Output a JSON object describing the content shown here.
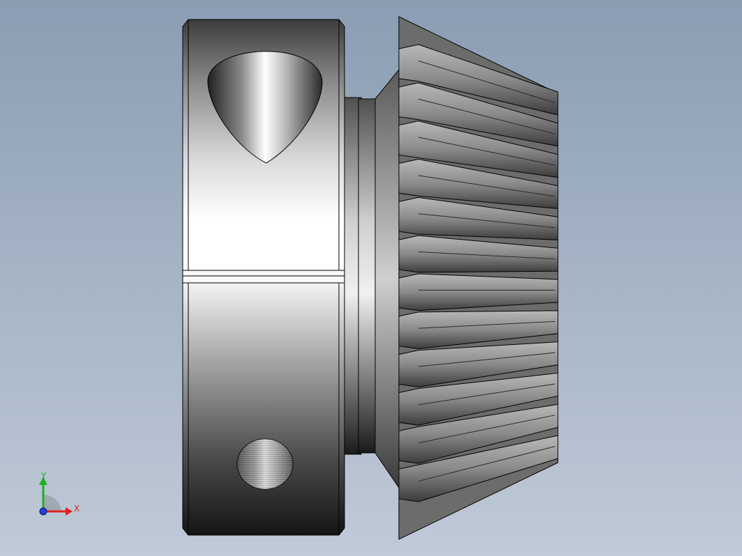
{
  "viewport": {
    "background_top": "#8a9db2",
    "background_bottom": "#c0cad8"
  },
  "model": {
    "parts": [
      "collar",
      "hub",
      "bevel-gear"
    ],
    "gear_tooth_count_visible": 12
  },
  "triad": {
    "x_label": "X",
    "y_label": "Y",
    "x_color": "#e02020",
    "y_color": "#20b020",
    "z_color": "#2040e0"
  }
}
